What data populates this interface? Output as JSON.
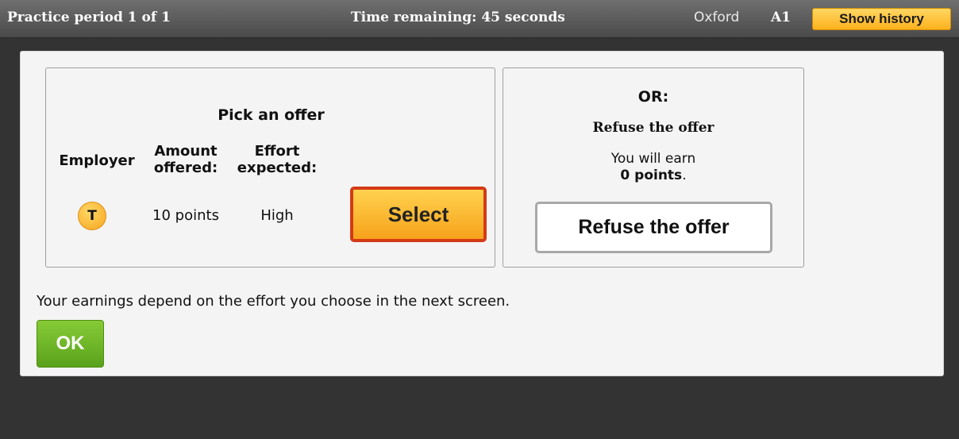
{
  "header": {
    "period": "Practice period 1 of 1",
    "timer": "Time remaining: 45 seconds",
    "city": "Oxford",
    "participant_id": "A1",
    "history_button": "Show history"
  },
  "offer": {
    "title": "Pick an offer",
    "columns": {
      "employer": "Employer",
      "amount": "Amount offered:",
      "effort": "Effort expected:"
    },
    "row": {
      "employer_initial": "T",
      "amount": "10 points",
      "effort": "High",
      "select_label": "Select"
    }
  },
  "refuse": {
    "or_label": "OR:",
    "title": "Refuse the offer",
    "earn_prefix": "You will earn",
    "earn_amount": "0 points",
    "earn_suffix": ".",
    "button_label": "Refuse the offer"
  },
  "note": "Your earnings depend on the effort you choose in the next screen.",
  "ok_label": "OK",
  "colors": {
    "accent_orange": "#ffb11c",
    "select_border": "#d43a16",
    "ok_green": "#5aa21c",
    "background": "#333333"
  }
}
